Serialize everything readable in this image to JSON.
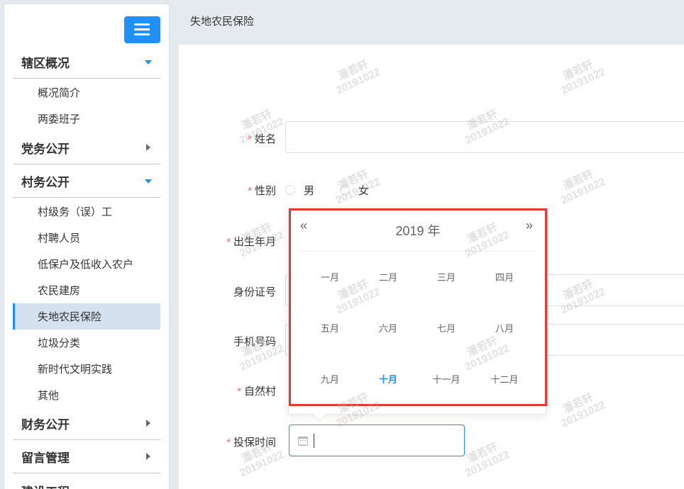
{
  "sidebar": {
    "sections": [
      {
        "label": "辖区概况",
        "expanded": true,
        "items": [
          "概况简介",
          "两委班子"
        ]
      },
      {
        "label": "党务公开",
        "expanded": false
      },
      {
        "label": "村务公开",
        "expanded": true,
        "items": [
          "村级务（误）工",
          "村聘人员",
          "低保户及低收入农户",
          "农民建房",
          "失地农民保险",
          "垃圾分类",
          "新时代文明实践",
          "其他"
        ],
        "active": "失地农民保险"
      },
      {
        "label": "财务公开",
        "expanded": false
      },
      {
        "label": "留言管理",
        "expanded": false
      },
      {
        "label": "建设工程",
        "expanded": false
      }
    ]
  },
  "header": {
    "title": "失地农民保险"
  },
  "form": {
    "required_mark": "*",
    "name_label": "姓名",
    "gender_label": "性别",
    "gender_options": [
      "男",
      "女"
    ],
    "birth_label": "出生年月",
    "id_label": "身份证号",
    "phone_label": "手机号码",
    "village_label": "自然村",
    "insure_date_label": "投保时间"
  },
  "month_picker": {
    "year": "2019 年",
    "prev": "«",
    "next": "»",
    "months": [
      "一月",
      "二月",
      "三月",
      "四月",
      "五月",
      "六月",
      "七月",
      "八月",
      "九月",
      "十月",
      "十一月",
      "十二月"
    ],
    "current_month": "十月"
  },
  "watermark": {
    "name": "潘若轩",
    "date": "20191022"
  },
  "colors": {
    "accent": "#1e90ff",
    "required": "#f56c6c",
    "highlight": "#e53935",
    "active_bg": "#d5e1ee"
  }
}
